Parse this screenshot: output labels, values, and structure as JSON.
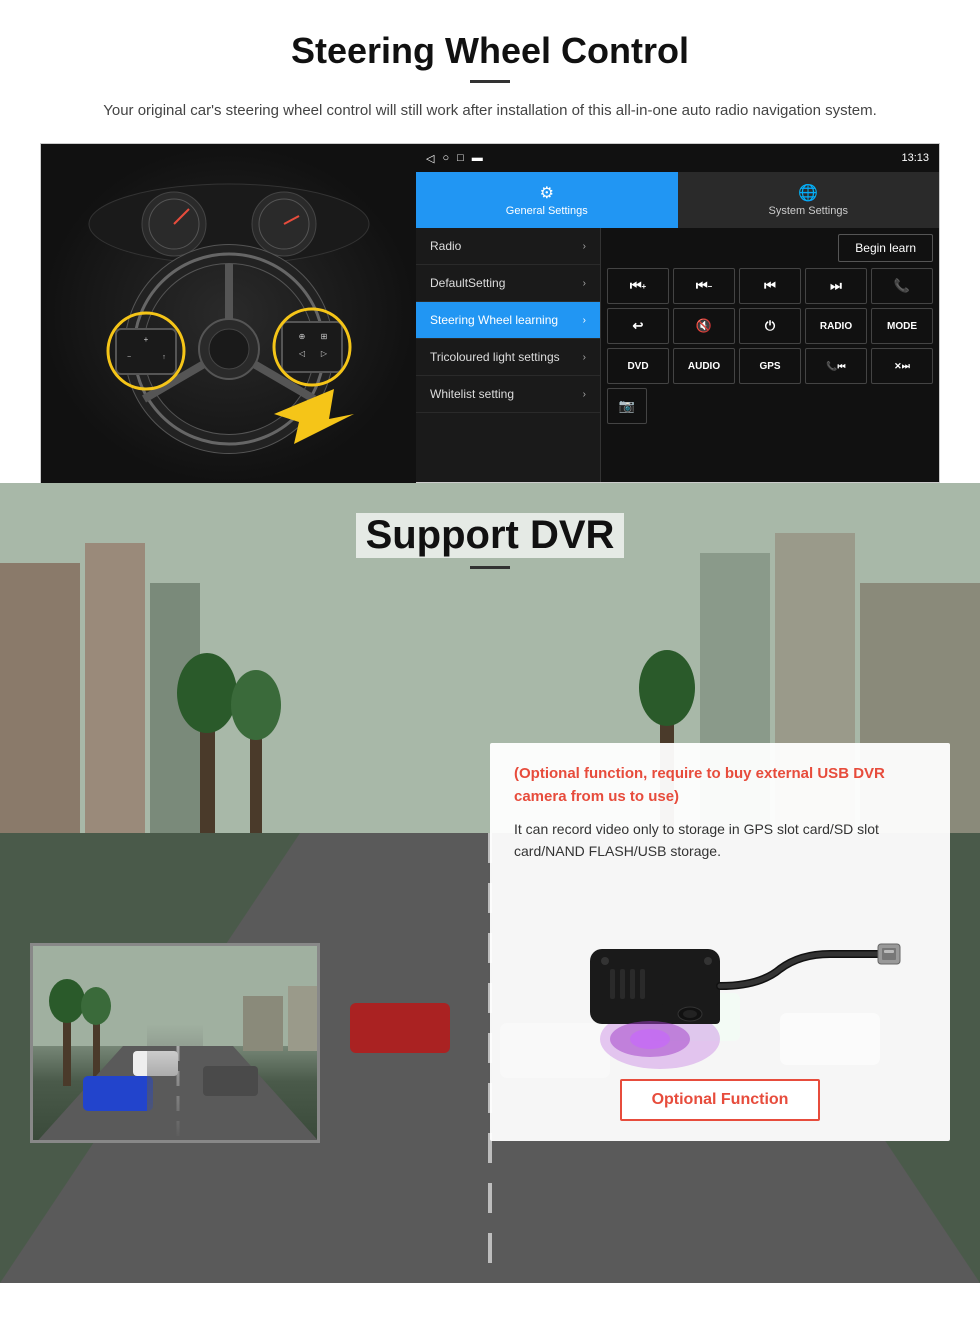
{
  "steering": {
    "title": "Steering Wheel Control",
    "subtitle": "Your original car's steering wheel control will still work after installation of this all-in-one auto radio navigation system.",
    "statusbar": {
      "time": "13:13",
      "signal_icon": "▼",
      "wifi_icon": "▾"
    },
    "tabs": {
      "general": "General Settings",
      "system": "System Settings",
      "general_icon": "⚙",
      "system_icon": "🌐"
    },
    "menu": {
      "items": [
        {
          "label": "Radio",
          "active": false
        },
        {
          "label": "DefaultSetting",
          "active": false
        },
        {
          "label": "Steering Wheel learning",
          "active": true
        },
        {
          "label": "Tricoloured light settings",
          "active": false
        },
        {
          "label": "Whitelist setting",
          "active": false
        }
      ]
    },
    "begin_learn": "Begin learn",
    "controls": {
      "row1": [
        "⏮+",
        "⏮-",
        "⏮",
        "⏭",
        "📞"
      ],
      "row2": [
        "↩",
        "🔇×",
        "⏻",
        "RADIO",
        "MODE"
      ],
      "row3": [
        "DVD",
        "AUDIO",
        "GPS",
        "📞⏮",
        "✕⏭"
      ],
      "row4": [
        "📷"
      ]
    }
  },
  "dvr": {
    "title": "Support DVR",
    "optional_text": "(Optional function, require to buy external USB DVR camera from us to use)",
    "desc_text": "It can record video only to storage in GPS slot card/SD slot card/NAND FLASH/USB storage.",
    "optional_btn": "Optional Function"
  }
}
